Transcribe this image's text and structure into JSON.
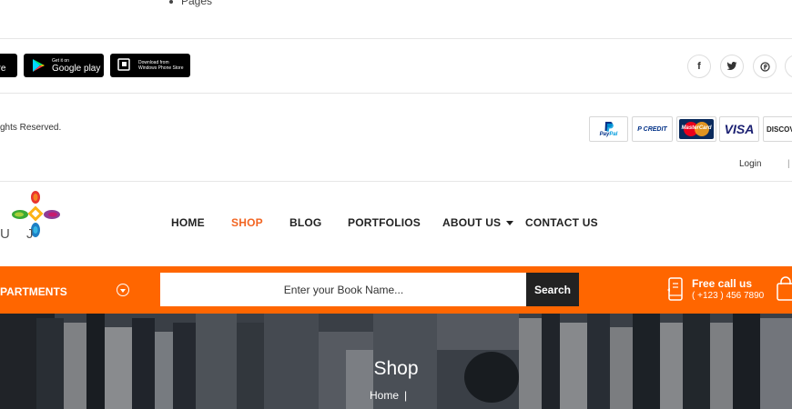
{
  "footer": {
    "list_item": "Pages",
    "badges": {
      "apple": {
        "small": "the",
        "big": "ore"
      },
      "google": {
        "small": "Get it on",
        "big": "Google play"
      },
      "windows": {
        "line1": "Download from",
        "line2": "Windows Phone Store"
      }
    },
    "social_icons": [
      "facebook-icon",
      "twitter-icon",
      "pinterest-icon",
      "more-icon"
    ],
    "copyright": "ghts Reserved.",
    "payments": [
      {
        "line1": "Pay",
        "line2": "Pal"
      },
      {
        "line1": "P CREDIT"
      },
      {
        "line1": "MasterCard"
      },
      {
        "line1": "VISA"
      },
      {
        "line1": "DISCOV"
      }
    ]
  },
  "topbar": {
    "login": "Login",
    "sep": "|"
  },
  "logo": {
    "text": "U J"
  },
  "nav": {
    "items": [
      "HOME",
      "SHOP",
      "BLOG",
      "PORTFOLIOS",
      "ABOUT US",
      "CONTACT US"
    ],
    "active": "SHOP"
  },
  "searchbar": {
    "departments_label": "PARTMENTS",
    "placeholder": "Enter your Book Name...",
    "button": "Search",
    "call_title": "Free call us",
    "call_number": "( +123 ) 456 7890"
  },
  "hero": {
    "title": "Shop",
    "breadcrumb_home": "Home",
    "breadcrumb_sep": "|"
  },
  "colors": {
    "accent": "#ff6600",
    "dark": "#222222",
    "text": "#333333"
  }
}
